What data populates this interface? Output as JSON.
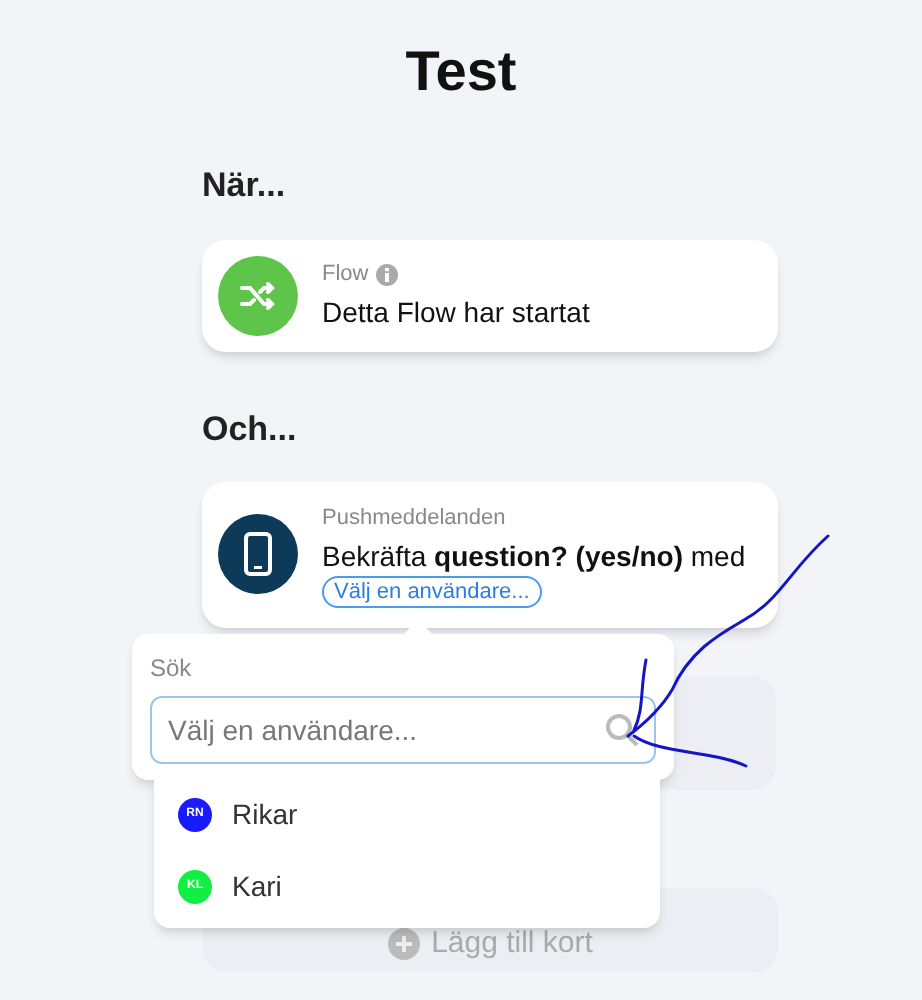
{
  "title": "Test",
  "sections": [
    {
      "heading": "När...",
      "card": {
        "kind": "flow",
        "category": "Flow",
        "info": true,
        "text": "Detta Flow har startat"
      }
    },
    {
      "heading": "Och...",
      "card": {
        "kind": "push",
        "category": "Pushmeddelanden",
        "text": "Bekräfta **question? (yes/no)** med",
        "token": "Välj en användare..."
      }
    }
  ],
  "add_card": {
    "label": "Lägg till kort"
  },
  "popover": {
    "label": "Sök",
    "search": {
      "placeholder": "Välj en användare..."
    }
  },
  "users": [
    {
      "initials": "RN",
      "name": "Rikar",
      "color": "#1a1aff"
    },
    {
      "initials": "KL",
      "name": "Kari",
      "color": "#11ee44"
    }
  ]
}
